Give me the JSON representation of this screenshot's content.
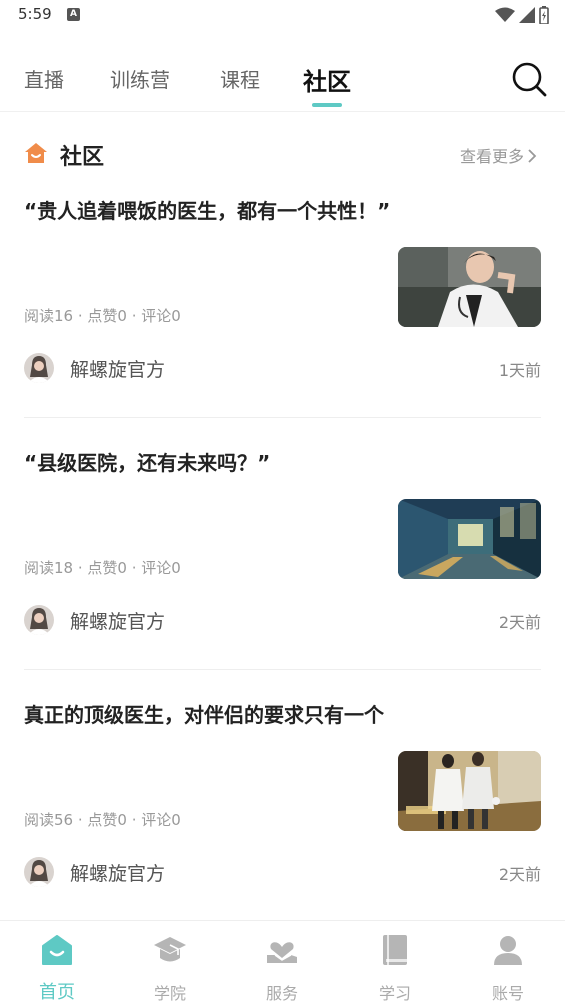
{
  "status_bar": {
    "time": "5:59"
  },
  "tabs": [
    {
      "label": "直播"
    },
    {
      "label": "训练营"
    },
    {
      "label": "课程"
    },
    {
      "label": "社区"
    }
  ],
  "active_tab": "社区",
  "section": {
    "title": "社区",
    "more_label": "查看更多"
  },
  "articles": [
    {
      "title": "“贵人追着喂饭的医生，都有一个共性！”",
      "stats": "阅读16 · 点赞0 · 评论0",
      "author": "解螺旋官方",
      "time": "1天前"
    },
    {
      "title": "“县级医院，还有未来吗？”",
      "stats": "阅读18 · 点赞0 · 评论0",
      "author": "解螺旋官方",
      "time": "2天前"
    },
    {
      "title": "真正的顶级医生，对伴侣的要求只有一个",
      "stats": "阅读56 · 点赞0 · 评论0",
      "author": "解螺旋官方",
      "time": "2天前"
    }
  ],
  "bottom_nav": [
    {
      "label": "首页"
    },
    {
      "label": "学院"
    },
    {
      "label": "服务"
    },
    {
      "label": "学习"
    },
    {
      "label": "账号"
    }
  ],
  "colors": {
    "accent": "#5ec9c4",
    "section_icon": "#f08c4a",
    "inactive": "#aaaaaa"
  }
}
